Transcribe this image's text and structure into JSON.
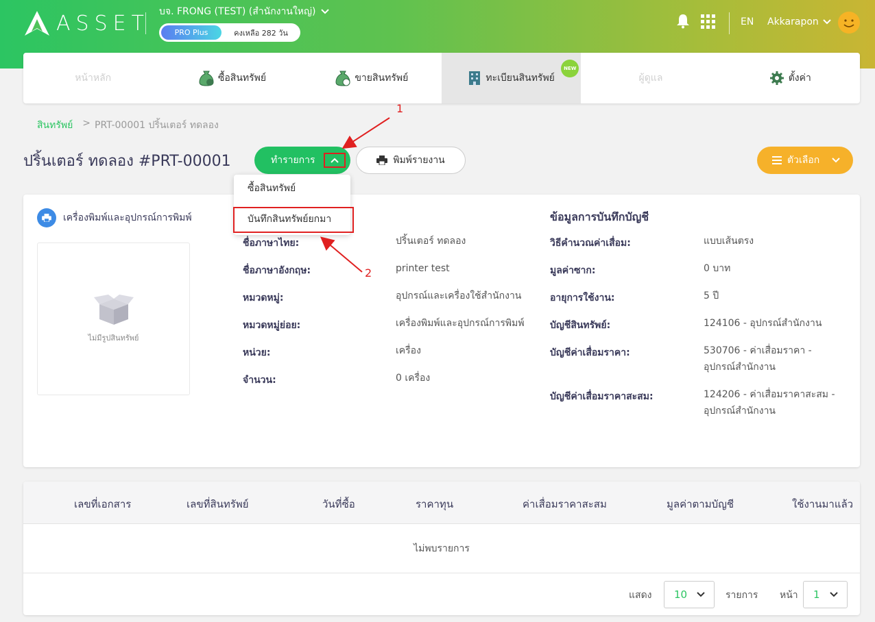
{
  "header": {
    "logo_text": "ASSET",
    "company": "บจ. FRONG (TEST) (สำนักงานใหญ่)",
    "plan": "PRO Plus",
    "days_left": "คงเหลือ 282 วัน",
    "language": "EN",
    "username": "Akkarapon"
  },
  "nav": {
    "home": "หน้าหลัก",
    "buy": "ซื้อสินทรัพย์",
    "sell": "ขายสินทรัพย์",
    "register": "ทะเบียนสินทรัพย์",
    "register_badge": "NEW",
    "caretaker": "ผู้ดูแล",
    "settings": "ตั้งค่า"
  },
  "breadcrumb": {
    "root": "สินทรัพย์",
    "separator": ">",
    "current": "PRT-00001 ปริ้นเตอร์ ทดลอง"
  },
  "page": {
    "title": "ปริ้นเตอร์ ทดลอง #PRT-00001",
    "action_button": "ทำรายการ",
    "print_button": "พิมพ์รายงาน",
    "options_button": "ตัวเลือก"
  },
  "dropdown": {
    "items": [
      "ซื้อสินทรัพย์",
      "บันทึกสินทรัพย์ยกมา"
    ]
  },
  "asset": {
    "category_header": "เครื่องพิมพ์และอุปกรณ์การพิมพ์",
    "no_image": "ไม่มีรูปสินทรัพย์",
    "details": [
      {
        "label": "ชื่อภาษาไทย:",
        "value": "ปริ้นเตอร์ ทดลอง"
      },
      {
        "label": "ชื่อภาษาอังกฤษ:",
        "value": "printer test"
      },
      {
        "label": "หมวดหมู่:",
        "value": "อุปกรณ์และเครื่องใช้สำนักงาน"
      },
      {
        "label": "หมวดหมู่ย่อย:",
        "value": "เครื่องพิมพ์และอุปกรณ์การพิมพ์"
      },
      {
        "label": "หน่วย:",
        "value": "เครื่อง"
      },
      {
        "label": "จำนวน:",
        "value": "0 เครื่อง"
      }
    ]
  },
  "accounting": {
    "title": "ข้อมูลการบันทึกบัญชี",
    "rows": [
      {
        "label": "วิธีคำนวณค่าเสื่อม:",
        "value": "แบบเส้นตรง"
      },
      {
        "label": "มูลค่าซาก:",
        "value": "0 บาท"
      },
      {
        "label": "อายุการใช้งาน:",
        "value": "5 ปี"
      },
      {
        "label": "บัญชีสินทรัพย์:",
        "value": "124106 - อุปกรณ์สำนักงาน"
      },
      {
        "label": "บัญชีค่าเสื่อมราคา:",
        "value": "530706 - ค่าเสื่อมราคา - อุปกรณ์สำนักงาน"
      },
      {
        "label": "บัญชีค่าเสื่อมราคาสะสม:",
        "value": "124206 - ค่าเสื่อมราคาสะสม - อุปกรณ์สำนักงาน"
      }
    ]
  },
  "table": {
    "headers": [
      "เลขที่เอกสาร",
      "เลขที่สินทรัพย์",
      "วันที่ซื้อ",
      "ราคาทุน",
      "ค่าเสื่อมราคาสะสม",
      "มูลค่าตามบัญชี",
      "ใช้งานมาแล้ว"
    ],
    "empty": "ไม่พบรายการ",
    "show_label": "แสดง",
    "page_size": "10",
    "items_label": "รายการ",
    "page_label": "หน้า",
    "page": "1"
  },
  "annotations": {
    "one": "1",
    "two": "2"
  },
  "colors": {
    "brand_green": "#22c062",
    "options_orange": "#f6b12a",
    "annotation_red": "#e02020"
  }
}
